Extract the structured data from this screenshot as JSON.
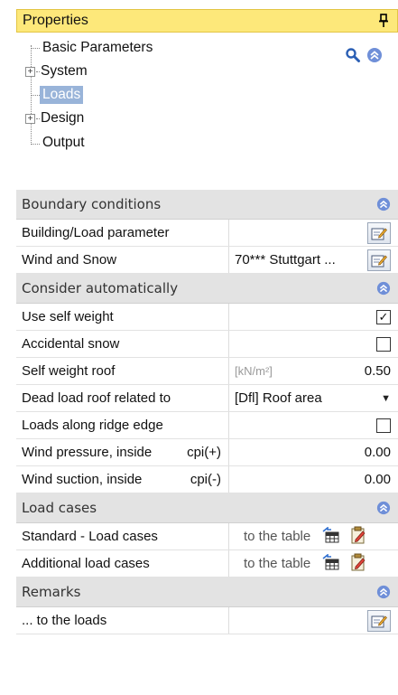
{
  "panel": {
    "title": "Properties",
    "pin_icon": "pin-icon",
    "tools": [
      "search-icon",
      "collapse-all-icon"
    ]
  },
  "tree": {
    "items": [
      {
        "label": "Basic Parameters",
        "expandable": false,
        "selected": false
      },
      {
        "label": "System",
        "expandable": true,
        "selected": false
      },
      {
        "label": "Loads",
        "expandable": false,
        "selected": true
      },
      {
        "label": "Design",
        "expandable": true,
        "selected": false
      },
      {
        "label": "Output",
        "expandable": false,
        "selected": false
      }
    ],
    "expander_symbol": "+"
  },
  "grid": {
    "boundary": {
      "title": "Boundary conditions",
      "building_load": {
        "label": "Building/Load parameter"
      },
      "wind_snow": {
        "label": "Wind and Snow",
        "value": "70*** Stuttgart ..."
      }
    },
    "auto": {
      "title": "Consider automatically",
      "self_weight": {
        "label": "Use self weight",
        "checked": true,
        "mark": "✓"
      },
      "accidental_snow": {
        "label": "Accidental snow",
        "checked": false
      },
      "self_weight_roof": {
        "label": "Self weight roof",
        "unit": "[kN/m²]",
        "value": "0.50"
      },
      "dead_load": {
        "label": "Dead load roof related to",
        "value": "[Dfl] Roof area",
        "arrow": "▼"
      },
      "ridge_edge": {
        "label": "Loads along ridge edge",
        "checked": false
      },
      "wind_pressure": {
        "label": "Wind pressure, inside",
        "suffix": "cpi(+)",
        "value": "0.00"
      },
      "wind_suction": {
        "label": "Wind suction, inside",
        "suffix": "cpi(-)",
        "value": "0.00"
      }
    },
    "load_cases": {
      "title": "Load cases",
      "standard": {
        "label": "Standard - Load cases",
        "link": "to the table"
      },
      "additional": {
        "label": "Additional load cases",
        "link": "to the table"
      }
    },
    "remarks": {
      "title": "Remarks",
      "to_loads": {
        "label": "... to the loads"
      }
    }
  },
  "colors": {
    "header_bg": "#fde87a",
    "selected_bg": "#99b4d9",
    "section_bg": "#e3e3e3",
    "collapse_icon": "#6f8fd8"
  }
}
